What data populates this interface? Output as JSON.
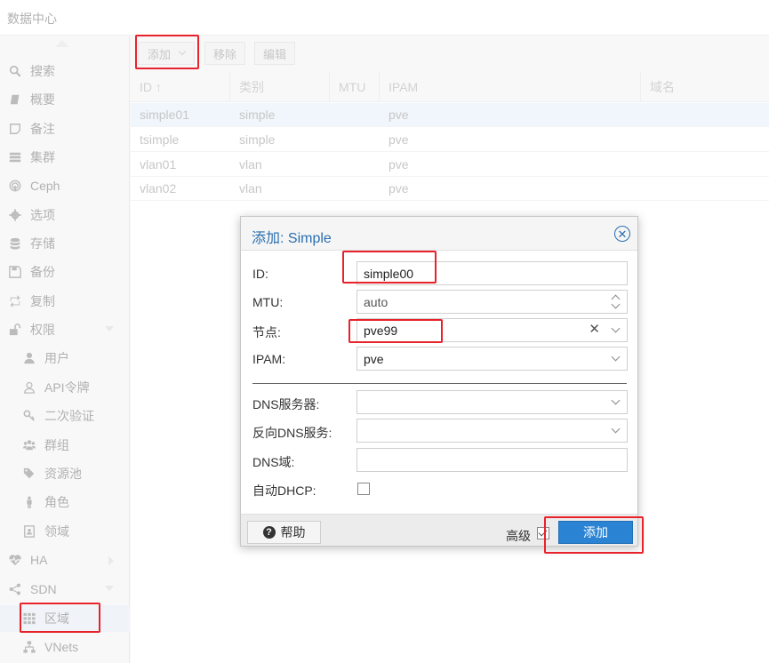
{
  "app": {
    "title": "数据中心"
  },
  "sidebar": {
    "items": [
      {
        "label": "搜索",
        "icon": "search-icon",
        "level": 0
      },
      {
        "label": "概要",
        "icon": "book-icon",
        "level": 0
      },
      {
        "label": "备注",
        "icon": "note-icon",
        "level": 0
      },
      {
        "label": "集群",
        "icon": "server-icon",
        "level": 0
      },
      {
        "label": "Ceph",
        "icon": "ceph-icon",
        "level": 0
      },
      {
        "label": "选项",
        "icon": "gear-icon",
        "level": 0
      },
      {
        "label": "存储",
        "icon": "database-icon",
        "level": 0
      },
      {
        "label": "备份",
        "icon": "floppy-icon",
        "level": 0
      },
      {
        "label": "复制",
        "icon": "retweet-icon",
        "level": 0
      },
      {
        "label": "权限",
        "icon": "unlock-icon",
        "level": 0
      },
      {
        "label": "用户",
        "icon": "user-icon",
        "level": 1
      },
      {
        "label": "API令牌",
        "icon": "user-outline-icon",
        "level": 1
      },
      {
        "label": "二次验证",
        "icon": "key-icon",
        "level": 1
      },
      {
        "label": "群组",
        "icon": "users-icon",
        "level": 1
      },
      {
        "label": "资源池",
        "icon": "tags-icon",
        "level": 1
      },
      {
        "label": "角色",
        "icon": "male-icon",
        "level": 1
      },
      {
        "label": "领域",
        "icon": "address-book-icon",
        "level": 1
      },
      {
        "label": "HA",
        "icon": "heartbeat-icon",
        "level": 0
      },
      {
        "label": "SDN",
        "icon": "sdn-icon",
        "level": 0
      },
      {
        "label": "区域",
        "icon": "grid-icon",
        "level": 1
      },
      {
        "label": "VNets",
        "icon": "network-icon",
        "level": 1
      }
    ]
  },
  "toolbar": {
    "add_label": "添加",
    "remove_label": "移除",
    "edit_label": "编辑"
  },
  "grid": {
    "columns": [
      "ID ↑",
      "类别",
      "MTU",
      "IPAM",
      "域名"
    ],
    "rows": [
      [
        "simple01",
        "simple",
        "",
        "pve",
        ""
      ],
      [
        "tsimple",
        "simple",
        "",
        "pve",
        ""
      ],
      [
        "vlan01",
        "vlan",
        "",
        "pve",
        ""
      ],
      [
        "vlan02",
        "vlan",
        "",
        "pve",
        ""
      ]
    ]
  },
  "dialog": {
    "title": "添加: Simple",
    "fields": {
      "id": {
        "label": "ID:",
        "value": "simple00"
      },
      "mtu": {
        "label": "MTU:",
        "value": "auto"
      },
      "nodes": {
        "label": "节点:",
        "value": "pve99"
      },
      "ipam": {
        "label": "IPAM:",
        "value": "pve"
      },
      "dns": {
        "label": "DNS服务器:",
        "value": ""
      },
      "reversedns": {
        "label": "反向DNS服务:",
        "value": ""
      },
      "dnszone": {
        "label": "DNS域:",
        "value": ""
      },
      "dhcp": {
        "label": "自动DHCP:"
      }
    },
    "footer": {
      "help_label": "帮助",
      "advanced_label": "高级",
      "add_label": "添加"
    }
  },
  "colors": {
    "accent": "#2a84d3",
    "title_blue": "#2a6fb0",
    "highlight_red": "#e8222b"
  }
}
